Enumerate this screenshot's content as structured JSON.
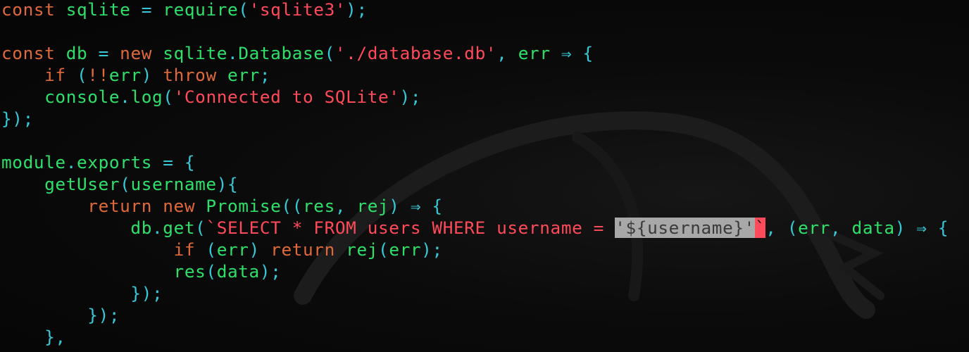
{
  "editor": {
    "lines": [
      [
        {
          "t": "kw",
          "s": "const"
        },
        {
          "t": "id",
          "s": " sqlite "
        },
        {
          "t": "pn",
          "s": "="
        },
        {
          "t": "id",
          "s": " require"
        },
        {
          "t": "pn",
          "s": "("
        },
        {
          "t": "str",
          "s": "'sqlite3'"
        },
        {
          "t": "pn",
          "s": ");"
        }
      ],
      [],
      [
        {
          "t": "kw",
          "s": "const"
        },
        {
          "t": "id",
          "s": " db "
        },
        {
          "t": "pn",
          "s": "="
        },
        {
          "t": "kw",
          "s": " new"
        },
        {
          "t": "id",
          "s": " sqlite"
        },
        {
          "t": "pn",
          "s": "."
        },
        {
          "t": "id",
          "s": "Database"
        },
        {
          "t": "pn",
          "s": "("
        },
        {
          "t": "str",
          "s": "'./database.db'"
        },
        {
          "t": "pn",
          "s": ","
        },
        {
          "t": "id",
          "s": " err "
        },
        {
          "t": "pn",
          "s": "⇒ {"
        }
      ],
      [
        {
          "t": "id",
          "s": "    "
        },
        {
          "t": "kw",
          "s": "if"
        },
        {
          "t": "pn",
          "s": " ("
        },
        {
          "t": "kw",
          "s": "!!"
        },
        {
          "t": "id",
          "s": "err"
        },
        {
          "t": "pn",
          "s": ")"
        },
        {
          "t": "kw",
          "s": " throw"
        },
        {
          "t": "id",
          "s": " err"
        },
        {
          "t": "pn",
          "s": ";"
        }
      ],
      [
        {
          "t": "id",
          "s": "    console"
        },
        {
          "t": "pn",
          "s": "."
        },
        {
          "t": "id",
          "s": "log"
        },
        {
          "t": "pn",
          "s": "("
        },
        {
          "t": "str",
          "s": "'Connected to SQLite'"
        },
        {
          "t": "pn",
          "s": ");"
        }
      ],
      [
        {
          "t": "pn",
          "s": "});"
        }
      ],
      [],
      [
        {
          "t": "id",
          "s": "module"
        },
        {
          "t": "pn",
          "s": "."
        },
        {
          "t": "id",
          "s": "exports "
        },
        {
          "t": "pn",
          "s": "= {"
        }
      ],
      [
        {
          "t": "id",
          "s": "    getUser"
        },
        {
          "t": "pn",
          "s": "("
        },
        {
          "t": "id",
          "s": "username"
        },
        {
          "t": "pn",
          "s": "){"
        }
      ],
      [
        {
          "t": "id",
          "s": "        "
        },
        {
          "t": "kw",
          "s": "return new"
        },
        {
          "t": "id",
          "s": " Promise"
        },
        {
          "t": "pn",
          "s": "(("
        },
        {
          "t": "id",
          "s": "res"
        },
        {
          "t": "pn",
          "s": ","
        },
        {
          "t": "id",
          "s": " rej"
        },
        {
          "t": "pn",
          "s": ") ⇒ {"
        }
      ],
      [
        {
          "t": "id",
          "s": "            db"
        },
        {
          "t": "pn",
          "s": "."
        },
        {
          "t": "id",
          "s": "get"
        },
        {
          "t": "pn",
          "s": "("
        },
        {
          "t": "str",
          "s": "`SELECT * FROM users WHERE username = "
        },
        {
          "t": "hl",
          "s": "'${username}'"
        },
        {
          "t": "cursor",
          "s": "`"
        },
        {
          "t": "pn",
          "s": ", ("
        },
        {
          "t": "id",
          "s": "err"
        },
        {
          "t": "pn",
          "s": ","
        },
        {
          "t": "id",
          "s": " data"
        },
        {
          "t": "pn",
          "s": ") ⇒ {"
        }
      ],
      [
        {
          "t": "id",
          "s": "                "
        },
        {
          "t": "kw",
          "s": "if"
        },
        {
          "t": "pn",
          "s": " ("
        },
        {
          "t": "id",
          "s": "err"
        },
        {
          "t": "pn",
          "s": ")"
        },
        {
          "t": "kw",
          "s": " return"
        },
        {
          "t": "id",
          "s": " rej"
        },
        {
          "t": "pn",
          "s": "("
        },
        {
          "t": "id",
          "s": "err"
        },
        {
          "t": "pn",
          "s": ");"
        }
      ],
      [
        {
          "t": "id",
          "s": "                res"
        },
        {
          "t": "pn",
          "s": "("
        },
        {
          "t": "id",
          "s": "data"
        },
        {
          "t": "pn",
          "s": ");"
        }
      ],
      [
        {
          "t": "id",
          "s": "            "
        },
        {
          "t": "pn",
          "s": "});"
        }
      ],
      [
        {
          "t": "id",
          "s": "        "
        },
        {
          "t": "pn",
          "s": "});"
        }
      ],
      [
        {
          "t": "id",
          "s": "    "
        },
        {
          "t": "pn",
          "s": "},"
        }
      ]
    ]
  },
  "colors": {
    "background": "#080808",
    "keyword": "#e0693a",
    "identifier": "#2ee06a",
    "string": "#ff4a5a",
    "punctuation": "#37c9d6",
    "selection": "#a8a8a8",
    "cursor": "#ff4a5a"
  }
}
